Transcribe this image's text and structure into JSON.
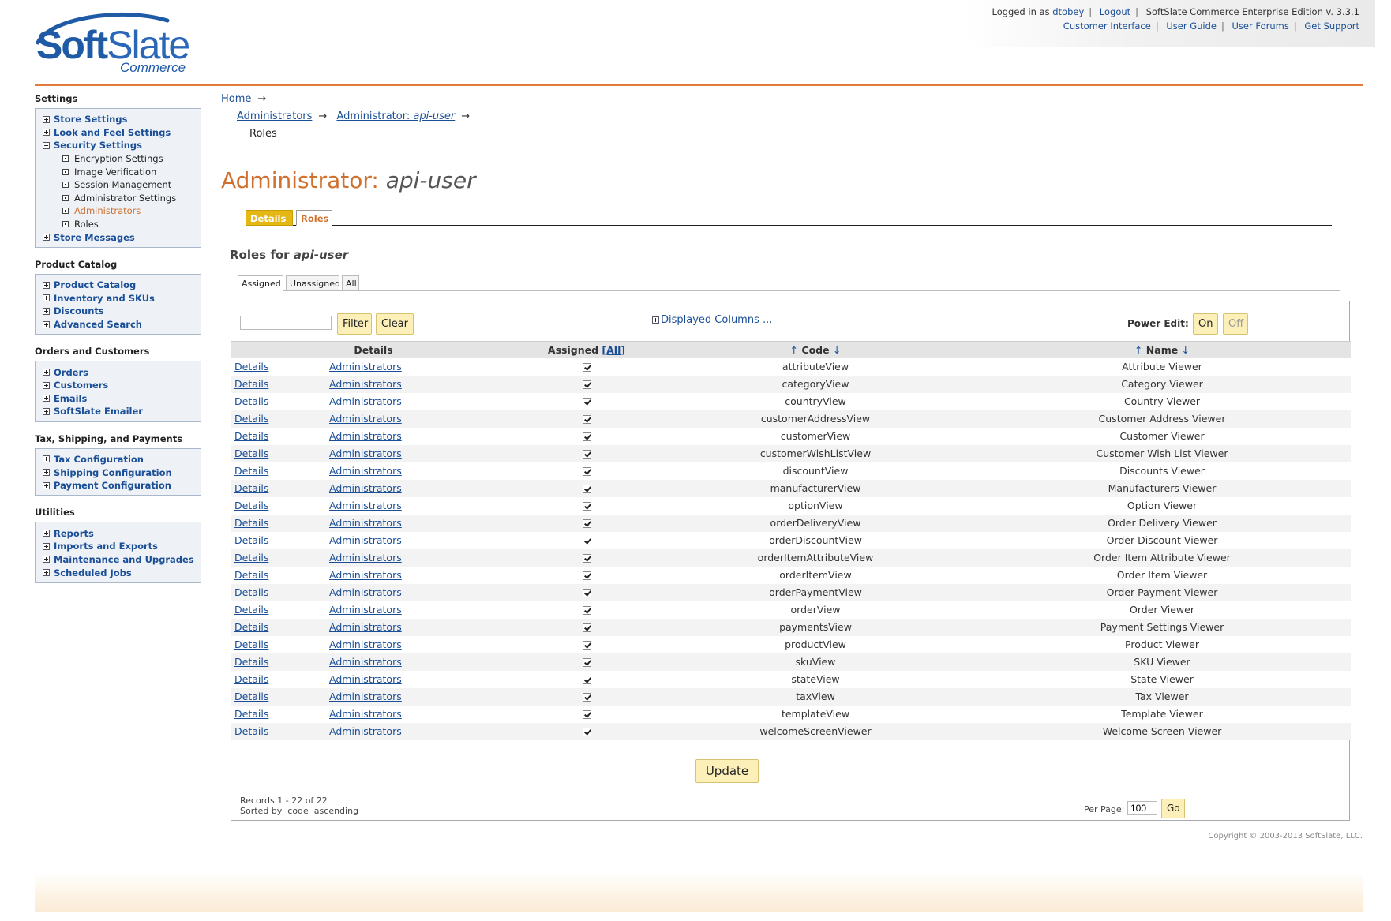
{
  "logo": {
    "brand_soft": "Soft",
    "brand_slate": "Slate",
    "subtitle": "Commerce"
  },
  "topbar": {
    "logged_in_prefix": "Logged in as",
    "username": "dtobey",
    "logout": "Logout",
    "edition": "SoftSlate Commerce Enterprise Edition v. 3.3.1",
    "links": [
      "Customer Interface",
      "User Guide",
      "User Forums",
      "Get Support"
    ]
  },
  "sidebar": {
    "settings": {
      "heading": "Settings",
      "store_settings": "Store Settings",
      "look_feel": "Look and Feel Settings",
      "security": "Security Settings",
      "security_sub": [
        "Encryption Settings",
        "Image Verification",
        "Session Management",
        "Administrator Settings",
        "Administrators",
        "Roles"
      ],
      "store_messages": "Store Messages"
    },
    "catalog": {
      "heading": "Product Catalog",
      "items": [
        "Product Catalog",
        "Inventory and SKUs",
        "Discounts",
        "Advanced Search"
      ]
    },
    "orders": {
      "heading": "Orders and Customers",
      "items": [
        "Orders",
        "Customers",
        "Emails",
        "SoftSlate Emailer"
      ]
    },
    "tax": {
      "heading": "Tax, Shipping, and Payments",
      "items": [
        "Tax Configuration",
        "Shipping Configuration",
        "Payment Configuration"
      ]
    },
    "utilities": {
      "heading": "Utilities",
      "items": [
        "Reports",
        "Imports and Exports",
        "Maintenance and Upgrades",
        "Scheduled Jobs"
      ]
    }
  },
  "breadcrumb": {
    "home": "Home",
    "administrators": "Administrators",
    "admin_prefix": "Administrator: ",
    "admin_user": "api-user",
    "current": "Roles",
    "arrow": "→"
  },
  "page": {
    "title_prefix": "Administrator: ",
    "title_user": "api-user",
    "tabs": [
      "Details",
      "Roles"
    ],
    "roles_for": "Roles for ",
    "roles_user": "api-user",
    "subtabs": [
      "Assigned",
      "Unassigned",
      "All"
    ]
  },
  "filter": {
    "input_value": "",
    "filter_btn": "Filter",
    "clear_btn": "Clear",
    "displayed_columns": "Displayed Columns ...",
    "power_edit_label": "Power Edit:",
    "on": "On",
    "off": "Off"
  },
  "grid": {
    "headers": {
      "details": "Details",
      "assigned": "Assigned",
      "assigned_all": "[All]",
      "code": "Code",
      "name": "Name",
      "up": "↑",
      "down": "↓"
    },
    "link_details": "Details",
    "link_admins": "Administrators",
    "rows": [
      {
        "code": "attributeView",
        "name": "Attribute Viewer",
        "assigned": true
      },
      {
        "code": "categoryView",
        "name": "Category Viewer",
        "assigned": true
      },
      {
        "code": "countryView",
        "name": "Country Viewer",
        "assigned": true
      },
      {
        "code": "customerAddressView",
        "name": "Customer Address Viewer",
        "assigned": true
      },
      {
        "code": "customerView",
        "name": "Customer Viewer",
        "assigned": true
      },
      {
        "code": "customerWishListView",
        "name": "Customer Wish List Viewer",
        "assigned": true
      },
      {
        "code": "discountView",
        "name": "Discounts Viewer",
        "assigned": true
      },
      {
        "code": "manufacturerView",
        "name": "Manufacturers Viewer",
        "assigned": true
      },
      {
        "code": "optionView",
        "name": "Option Viewer",
        "assigned": true
      },
      {
        "code": "orderDeliveryView",
        "name": "Order Delivery Viewer",
        "assigned": true
      },
      {
        "code": "orderDiscountView",
        "name": "Order Discount Viewer",
        "assigned": true
      },
      {
        "code": "orderItemAttributeView",
        "name": "Order Item Attribute Viewer",
        "assigned": true
      },
      {
        "code": "orderItemView",
        "name": "Order Item Viewer",
        "assigned": true
      },
      {
        "code": "orderPaymentView",
        "name": "Order Payment Viewer",
        "assigned": true
      },
      {
        "code": "orderView",
        "name": "Order Viewer",
        "assigned": true
      },
      {
        "code": "paymentsView",
        "name": "Payment Settings Viewer",
        "assigned": true
      },
      {
        "code": "productView",
        "name": "Product Viewer",
        "assigned": true
      },
      {
        "code": "skuView",
        "name": "SKU Viewer",
        "assigned": true
      },
      {
        "code": "stateView",
        "name": "State Viewer",
        "assigned": true
      },
      {
        "code": "taxView",
        "name": "Tax Viewer",
        "assigned": true
      },
      {
        "code": "templateView",
        "name": "Template Viewer",
        "assigned": true
      },
      {
        "code": "welcomeScreenViewer",
        "name": "Welcome Screen Viewer",
        "assigned": true
      }
    ],
    "update_btn": "Update"
  },
  "footer": {
    "records": "Records 1 - 22 of 22",
    "sorted": "Sorted by  code  ascending",
    "per_page_label": "Per Page:",
    "per_page_value": "100",
    "go_btn": "Go",
    "copyright": "Copyright © 2003-2013 SoftSlate, LLC."
  },
  "colors": {
    "accent_orange": "#d0702e",
    "link_blue": "#1a4e96",
    "tab_gold": "#e5b715",
    "button_yellow": "#fcf0b8"
  }
}
